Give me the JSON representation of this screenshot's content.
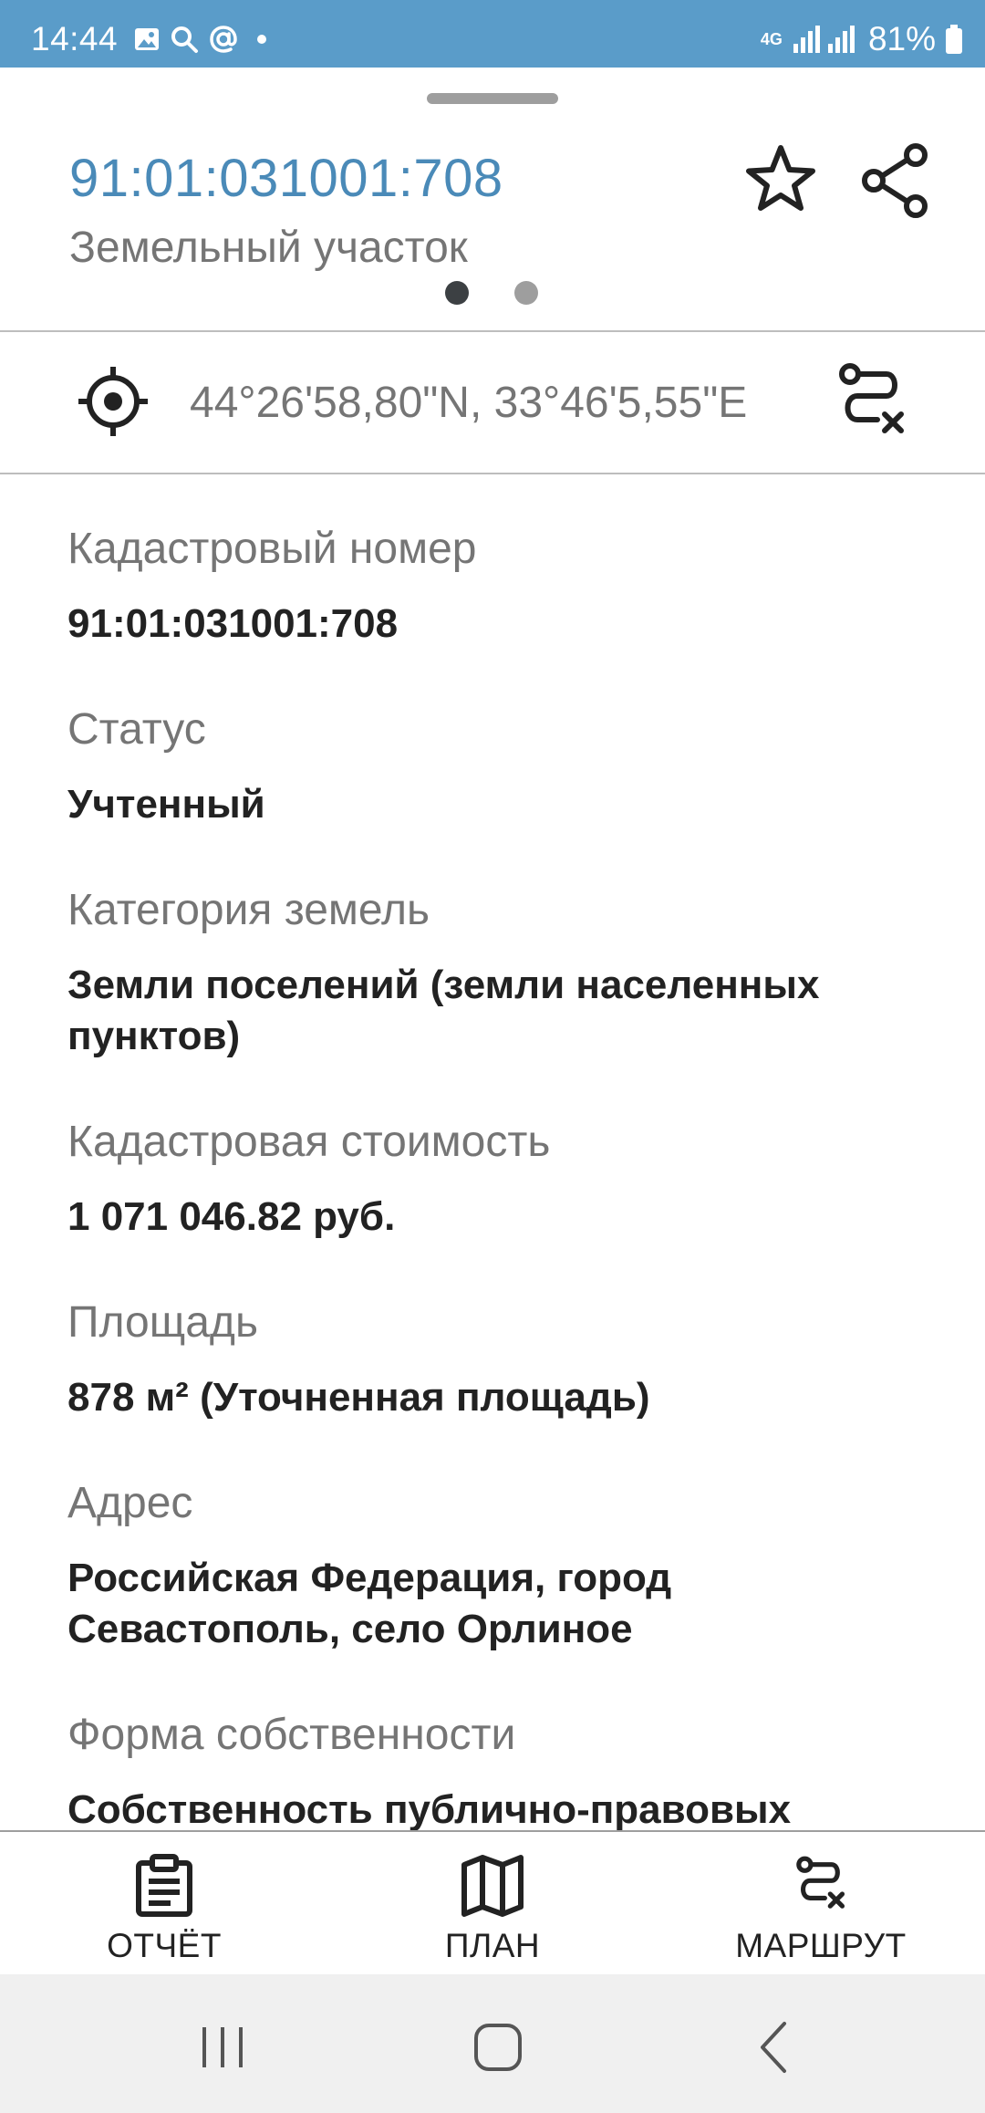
{
  "status_bar": {
    "time": "14:44",
    "battery": "81%",
    "network": "4G",
    "icons": [
      "gallery-icon",
      "search-icon",
      "at-icon",
      "dot-icon",
      "signal-icon",
      "battery-icon"
    ]
  },
  "header": {
    "title": "91:01:031001:708",
    "subtitle": "Земельный участок",
    "pager": {
      "count": 2,
      "active": 1
    }
  },
  "coordinates": {
    "text": "44°26'58,80\"N, 33°46'5,55\"E"
  },
  "fields": [
    {
      "label": "Кадастровый номер",
      "value": "91:01:031001:708"
    },
    {
      "label": "Статус",
      "value": "Учтенный"
    },
    {
      "label": "Категория земель",
      "value": "Земли поселений (земли населенных пунктов)"
    },
    {
      "label": "Кадастровая стоимость",
      "value": "1 071 046.82 руб."
    },
    {
      "label": "Площадь",
      "value": "878 м² (Уточненная площадь)"
    },
    {
      "label": "Адрес",
      "value": "Российская Федерация, город Севастополь, село Орлиное"
    },
    {
      "label": "Форма собственности",
      "value": "Собственность публично-правовых"
    }
  ],
  "bottom_nav": [
    {
      "label": "ОТЧЁТ",
      "icon": "clipboard-icon"
    },
    {
      "label": "ПЛАН",
      "icon": "map-icon"
    },
    {
      "label": "МАРШРУТ",
      "icon": "route-icon"
    }
  ],
  "colors": {
    "status_bar": "#5a9cc9",
    "title": "#4a8ab8",
    "label": "#757575",
    "value": "#222222"
  }
}
